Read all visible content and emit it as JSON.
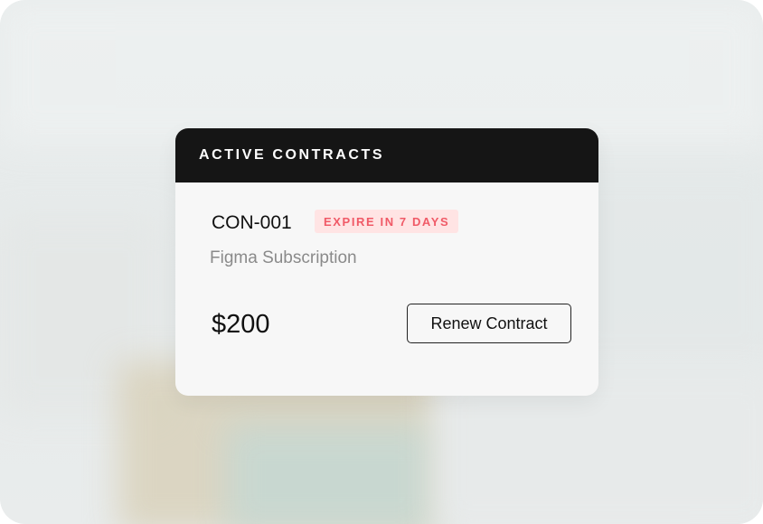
{
  "card": {
    "title": "ACTIVE CONTRACTS",
    "contract_id": "CON-001",
    "status_badge": "EXPIRE IN 7 DAYS",
    "subtitle": "Figma Subscription",
    "price": "$200",
    "renew_button_label": "Renew Contract"
  },
  "colors": {
    "header_bg": "#151515",
    "badge_bg": "#ffe4e4",
    "badge_text": "#f05a67",
    "card_bg": "#f7f7f7"
  }
}
